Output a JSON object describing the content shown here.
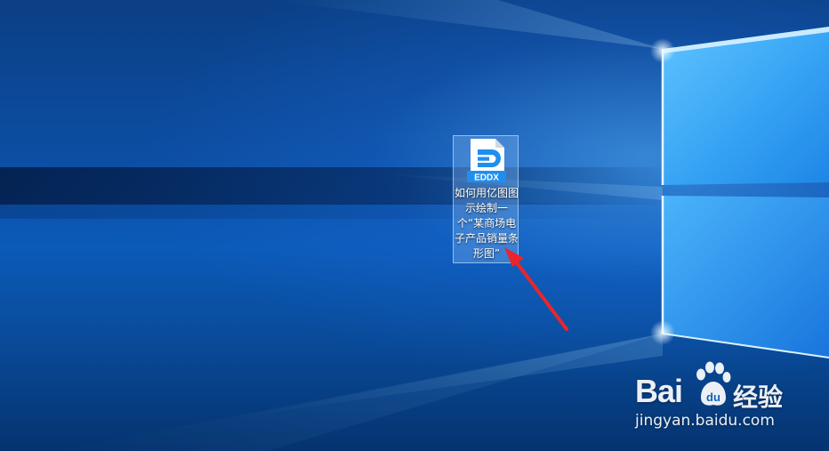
{
  "desktop": {
    "file": {
      "icon": "eddx-file-icon",
      "type_label": "EDDX",
      "name": "如何用亿图图示绘制一个“某商场电子产品销量条形图”",
      "selected": true
    },
    "annotation": {
      "icon": "red-arrow-icon",
      "color": "#e8262b"
    }
  },
  "watermark": {
    "brand": "Bai",
    "brand_suffix": "du",
    "service": "经验",
    "url": "jingyan.baidu.com"
  },
  "colors": {
    "accent": "#1e8ff0",
    "wallpaper": "#0c4ea3",
    "arrow": "#e8262b"
  }
}
